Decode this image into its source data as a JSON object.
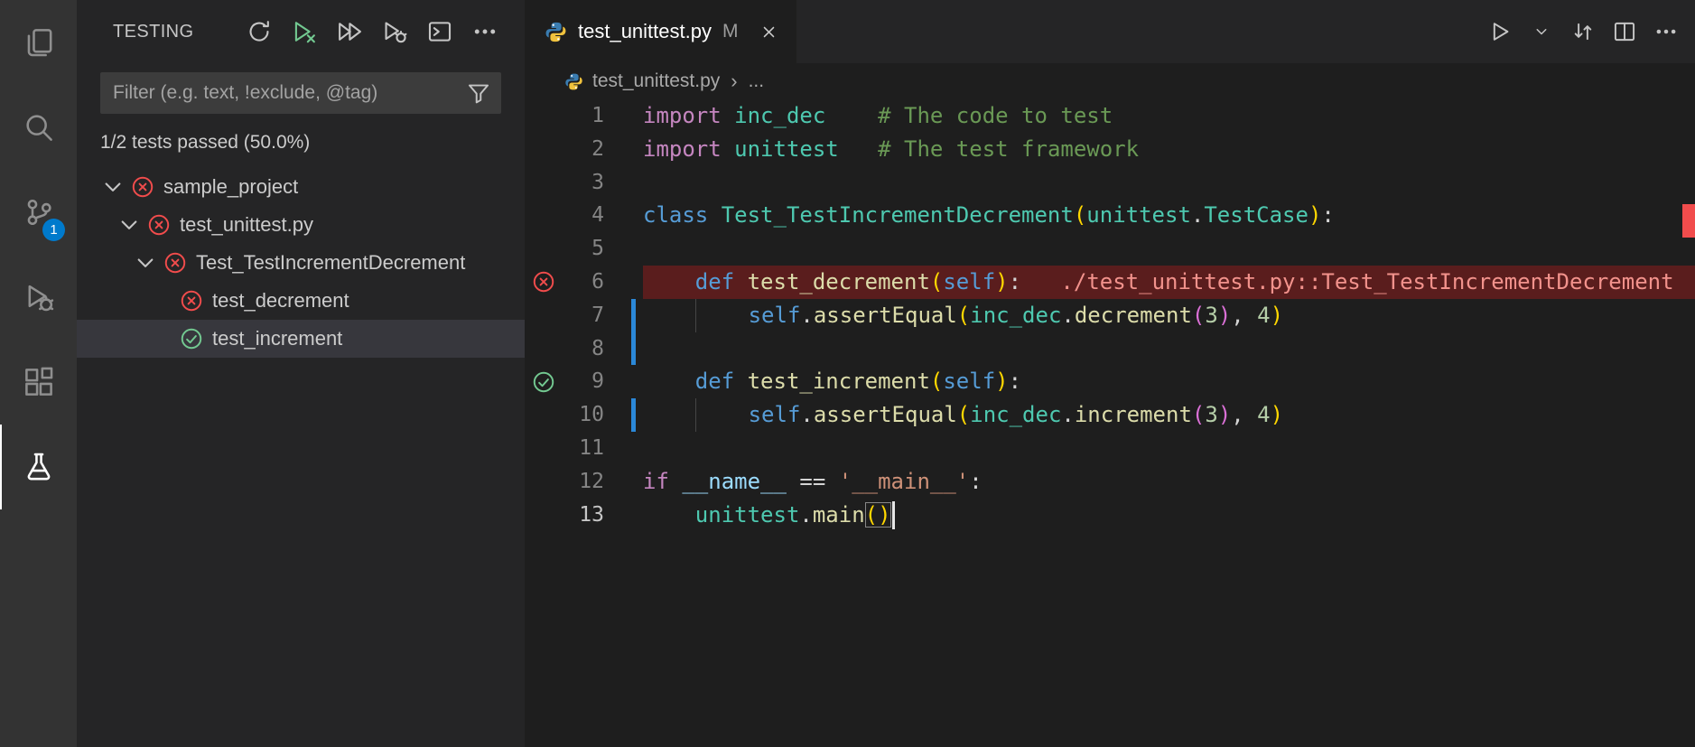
{
  "colors": {
    "accent": "#007acc",
    "error": "#f14c4c",
    "pass": "#73c991",
    "modified_gutter": "#2b88d8",
    "error_line_bg": "#5a1d1d"
  },
  "activity_bar": {
    "items": [
      {
        "name": "explorer",
        "icon": "files"
      },
      {
        "name": "search",
        "icon": "search"
      },
      {
        "name": "source-control",
        "icon": "source-control",
        "badge": "1"
      },
      {
        "name": "run-and-debug",
        "icon": "run-debug"
      },
      {
        "name": "extensions",
        "icon": "extensions"
      },
      {
        "name": "testing",
        "icon": "beaker",
        "active": true
      }
    ]
  },
  "sidebar": {
    "title": "TESTING",
    "toolbar": [
      {
        "name": "refresh-tests",
        "icon": "refresh"
      },
      {
        "name": "rerun-failed-tests",
        "icon": "run-failed",
        "green": true
      },
      {
        "name": "run-all-tests",
        "icon": "run-all"
      },
      {
        "name": "debug-all-tests",
        "icon": "debug-alt"
      },
      {
        "name": "show-test-output",
        "icon": "output"
      },
      {
        "name": "more-actions",
        "icon": "more"
      }
    ],
    "filter": {
      "placeholder": "Filter (e.g. text, !exclude, @tag)"
    },
    "status": "1/2 tests passed (50.0%)",
    "tree": [
      {
        "label": "sample_project",
        "state": "fail",
        "expanded": true,
        "indent": 0
      },
      {
        "label": "test_unittest.py",
        "state": "fail",
        "expanded": true,
        "indent": 1
      },
      {
        "label": "Test_TestIncrementDecrement",
        "state": "fail",
        "expanded": true,
        "indent": 2
      },
      {
        "label": "test_decrement",
        "state": "fail",
        "leaf": true,
        "indent": 3
      },
      {
        "label": "test_increment",
        "state": "pass",
        "leaf": true,
        "indent": 3,
        "selected": true
      }
    ]
  },
  "editor": {
    "tab": {
      "label": "test_unittest.py",
      "modified": "M"
    },
    "actions": [
      {
        "name": "run-python-file",
        "icon": "play"
      },
      {
        "name": "run-options-dropdown",
        "icon": "chevron-sm"
      },
      {
        "name": "open-changes",
        "icon": "swap"
      },
      {
        "name": "split-editor",
        "icon": "split"
      },
      {
        "name": "editor-more-actions",
        "icon": "more"
      }
    ],
    "breadcrumb": {
      "file": "test_unittest.py",
      "sep": "›",
      "more": "..."
    },
    "code": {
      "lines": [
        {
          "n": "1",
          "tokens": [
            [
              "ctrl",
              "import"
            ],
            [
              "pl",
              " "
            ],
            [
              "type",
              "inc_dec"
            ],
            [
              "pl",
              "    "
            ],
            [
              "cm",
              "# The code to test"
            ]
          ]
        },
        {
          "n": "2",
          "tokens": [
            [
              "ctrl",
              "import"
            ],
            [
              "pl",
              " "
            ],
            [
              "type",
              "unittest"
            ],
            [
              "pl",
              "   "
            ],
            [
              "cm",
              "# The test framework"
            ]
          ]
        },
        {
          "n": "3",
          "tokens": []
        },
        {
          "n": "4",
          "tokens": [
            [
              "kw",
              "class"
            ],
            [
              "pl",
              " "
            ],
            [
              "type",
              "Test_TestIncrementDecrement"
            ],
            [
              "b1",
              "("
            ],
            [
              "type",
              "unittest"
            ],
            [
              "pl",
              "."
            ],
            [
              "type",
              "TestCase"
            ],
            [
              "b1",
              ")"
            ],
            [
              "pl",
              ":"
            ]
          ]
        },
        {
          "n": "5",
          "tokens": []
        },
        {
          "n": "6",
          "state": "fail",
          "error": true,
          "tokens": [
            [
              "pl",
              "    "
            ],
            [
              "kw",
              "def"
            ],
            [
              "pl",
              " "
            ],
            [
              "fn",
              "test_decrement"
            ],
            [
              "b1",
              "("
            ],
            [
              "kw",
              "self"
            ],
            [
              "b1",
              ")"
            ],
            [
              "pl",
              ":"
            ],
            [
              "pl",
              "   "
            ],
            [
              "msg",
              "./test_unittest.py::Test_TestIncrementDecrement"
            ]
          ]
        },
        {
          "n": "7",
          "modified": true,
          "tokens": [
            [
              "pl",
              "    "
            ],
            [
              "guide",
              ""
            ],
            [
              "pl",
              "    "
            ],
            [
              "kw",
              "self"
            ],
            [
              "pl",
              "."
            ],
            [
              "fn",
              "assertEqual"
            ],
            [
              "b1",
              "("
            ],
            [
              "type",
              "inc_dec"
            ],
            [
              "pl",
              "."
            ],
            [
              "fn",
              "decrement"
            ],
            [
              "b2",
              "("
            ],
            [
              "num",
              "3"
            ],
            [
              "b2",
              ")"
            ],
            [
              "pl",
              ", "
            ],
            [
              "num",
              "4"
            ],
            [
              "b1",
              ")"
            ]
          ]
        },
        {
          "n": "8",
          "modified": true,
          "tokens": []
        },
        {
          "n": "9",
          "state": "pass",
          "tokens": [
            [
              "pl",
              "    "
            ],
            [
              "kw",
              "def"
            ],
            [
              "pl",
              " "
            ],
            [
              "fn",
              "test_increment"
            ],
            [
              "b1",
              "("
            ],
            [
              "kw",
              "self"
            ],
            [
              "b1",
              ")"
            ],
            [
              "pl",
              ":"
            ]
          ]
        },
        {
          "n": "10",
          "modified": true,
          "tokens": [
            [
              "pl",
              "    "
            ],
            [
              "guide",
              ""
            ],
            [
              "pl",
              "    "
            ],
            [
              "kw",
              "self"
            ],
            [
              "pl",
              "."
            ],
            [
              "fn",
              "assertEqual"
            ],
            [
              "b1",
              "("
            ],
            [
              "type",
              "inc_dec"
            ],
            [
              "pl",
              "."
            ],
            [
              "fn",
              "increment"
            ],
            [
              "b2",
              "("
            ],
            [
              "num",
              "3"
            ],
            [
              "b2",
              ")"
            ],
            [
              "pl",
              ", "
            ],
            [
              "num",
              "4"
            ],
            [
              "b1",
              ")"
            ]
          ]
        },
        {
          "n": "11",
          "tokens": []
        },
        {
          "n": "12",
          "tokens": [
            [
              "ctrl",
              "if"
            ],
            [
              "pl",
              " "
            ],
            [
              "var",
              "__name__"
            ],
            [
              "pl",
              " == "
            ],
            [
              "str",
              "'__main__'"
            ],
            [
              "pl",
              ":"
            ]
          ]
        },
        {
          "n": "13",
          "active": true,
          "tokens": [
            [
              "pl",
              "    "
            ],
            [
              "type",
              "unittest"
            ],
            [
              "pl",
              "."
            ],
            [
              "fn",
              "main"
            ],
            [
              "match",
              "()"
            ],
            [
              "cursor",
              ""
            ]
          ]
        }
      ]
    }
  }
}
